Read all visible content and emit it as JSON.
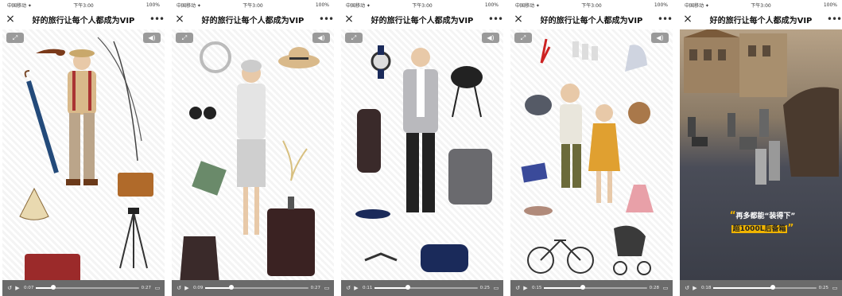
{
  "status": {
    "carrier": "中国移动 ✦",
    "time": "下午3:00",
    "battery": "100%"
  },
  "nav": {
    "title": "好的旅行让每个人都成为VIP",
    "close_icon": "×",
    "more_icon": "•••"
  },
  "video": {
    "fullscreen_icon": "⤢",
    "mute_icon": "◀)"
  },
  "phones": [
    {
      "time_current": "0:07",
      "time_total": "0:27",
      "progress": 0.17
    },
    {
      "time_current": "0:09",
      "time_total": "0:27",
      "progress": 0.25
    },
    {
      "time_current": "0:11",
      "time_total": "0:25",
      "progress": 0.32
    },
    {
      "time_current": "0:15",
      "time_total": "0:28",
      "progress": 0.38
    },
    {
      "time_current": "0:18",
      "time_total": "0:25",
      "progress": 0.58
    }
  ],
  "caption": {
    "line1": "再多都能“装得下”",
    "line2": "超1000L后备箱"
  },
  "colors": {
    "accent": "#f0b400",
    "control_bg": "#6b6b6b"
  }
}
